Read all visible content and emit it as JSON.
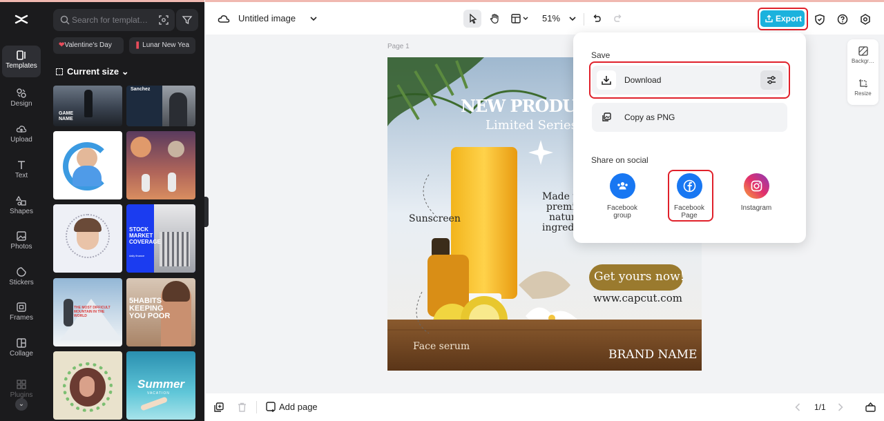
{
  "rail": {
    "items": [
      {
        "label": "Templates",
        "icon": "templates-icon"
      },
      {
        "label": "Design",
        "icon": "design-icon"
      },
      {
        "label": "Upload",
        "icon": "upload-icon"
      },
      {
        "label": "Text",
        "icon": "text-icon"
      },
      {
        "label": "Shapes",
        "icon": "shapes-icon"
      },
      {
        "label": "Photos",
        "icon": "photos-icon"
      },
      {
        "label": "Stickers",
        "icon": "stickers-icon"
      },
      {
        "label": "Frames",
        "icon": "frames-icon"
      },
      {
        "label": "Collage",
        "icon": "collage-icon"
      },
      {
        "label": "Plugins",
        "icon": "plugins-icon"
      }
    ]
  },
  "panel": {
    "search_placeholder": "Search for templat…",
    "chips": [
      "Valentine's Day",
      "Lunar New Yea"
    ],
    "size_label": "Current size",
    "thumbs": {
      "game_text": "GAME NAME",
      "sanchez": "Sanchez",
      "stock": "STOCK MARKET COVERAGE",
      "stock_sub": "daily finance",
      "habits": "5HABITS KEEPING YOU POOR",
      "mountain": "THE MOST DIFFICULT MOUNTAIN IN THE WORLD",
      "summer": "Summer",
      "summer_sub": "VACATION"
    }
  },
  "topbar": {
    "title": "Untitled image",
    "zoom": "51%",
    "export_label": "Export"
  },
  "rpanel": {
    "background": "Backgr…",
    "resize": "Resize"
  },
  "canvas": {
    "page_label": "Page 1",
    "headline": "NEW PRODUC",
    "subheadline": "Limited Series",
    "sunscreen": "Sunscreen",
    "made_with": "Made w",
    "made_with_2": "premi",
    "made_with_3": "natur",
    "made_with_4": "ingredi",
    "cta": "Get yours now!",
    "url": "www.capcut.com",
    "face_serum": "Face serum",
    "brand": "BRAND NAME"
  },
  "dropdown": {
    "save_heading": "Save",
    "download_label": "Download",
    "copy_label": "Copy as PNG",
    "share_heading": "Share on social",
    "social": [
      {
        "label": "Facebook group",
        "color": "#1877f2"
      },
      {
        "label": "Facebook Page",
        "color": "#1877f2"
      },
      {
        "label": "Instagram",
        "color": "#e1306c"
      }
    ]
  },
  "bottombar": {
    "add_page": "Add page",
    "page_counter": "1/1"
  },
  "colors": {
    "accent": "#1bb2dd",
    "highlight": "#e0202a",
    "panel_bg": "#1b1b1d"
  }
}
